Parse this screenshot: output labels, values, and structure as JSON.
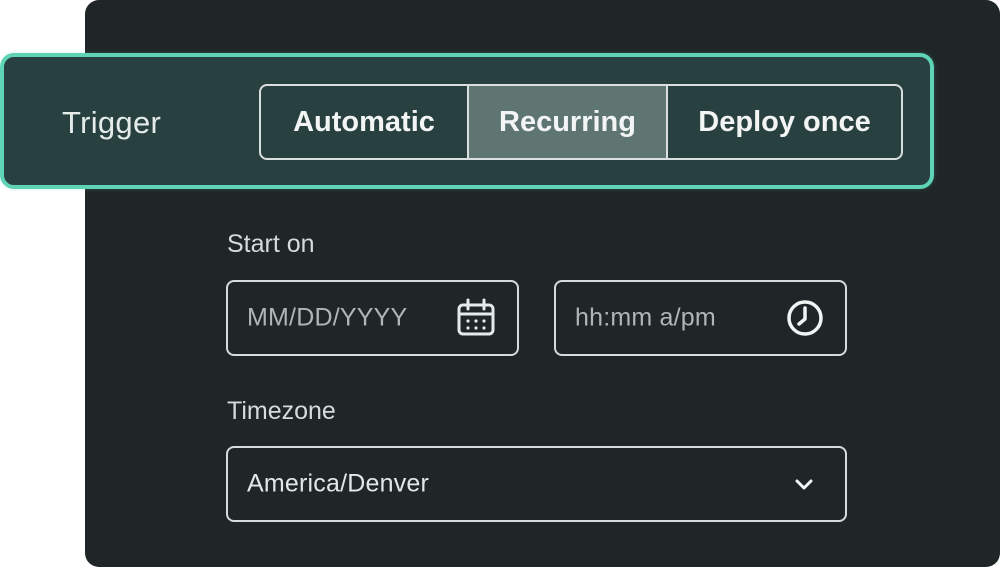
{
  "trigger": {
    "label": "Trigger",
    "options": [
      "Automatic",
      "Recurring",
      "Deploy once"
    ],
    "selected": "Recurring",
    "accent_color": "#5ed3b6"
  },
  "start_on": {
    "label": "Start on",
    "date_placeholder": "MM/DD/YYYY",
    "date_icon": "calendar-icon",
    "time_placeholder": "hh:mm a/pm",
    "time_icon": "clock-icon"
  },
  "timezone": {
    "label": "Timezone",
    "value": "America/Denver",
    "icon": "chevron-down-icon"
  }
}
